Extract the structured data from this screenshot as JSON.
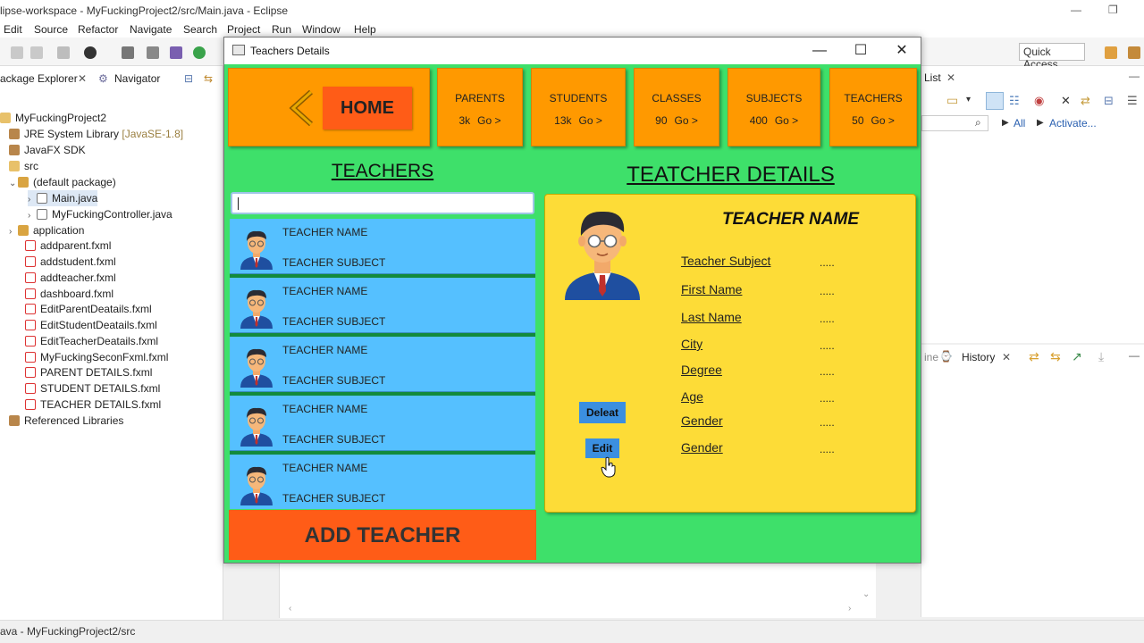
{
  "eclipse": {
    "title": "lipse-workspace - MyFuckingProject2/src/Main.java - Eclipse",
    "menu": [
      "Edit",
      "Source",
      "Refactor",
      "Navigate",
      "Search",
      "Project",
      "Run",
      "Window",
      "Help"
    ],
    "quick_access": "Quick Access",
    "package_explorer_tab": "ackage Explorer",
    "navigator_tab": "Navigator",
    "right_tab_list": "List",
    "right_tab_history": "History",
    "right_links": {
      "all": "All",
      "activate": "Activate..."
    },
    "status": "ava - MyFuckingProject2/src",
    "tree": [
      {
        "label": "MyFuckingProject2",
        "icon": "project-icon"
      },
      {
        "label": "JRE System Library",
        "suffix": "[JavaSE-1.8]",
        "icon": "library-icon"
      },
      {
        "label": "JavaFX SDK",
        "icon": "library-icon"
      },
      {
        "label": "src",
        "icon": "folder-icon"
      },
      {
        "label": "(default package)",
        "icon": "package-icon"
      },
      {
        "label": "Main.java",
        "icon": "java-file-icon"
      },
      {
        "label": "MyFuckingController.java",
        "icon": "java-file-icon"
      },
      {
        "label": "application",
        "icon": "package-icon"
      },
      {
        "label": "addparent.fxml",
        "icon": "fxml-file-icon"
      },
      {
        "label": "addstudent.fxml",
        "icon": "fxml-file-icon"
      },
      {
        "label": "addteacher.fxml",
        "icon": "fxml-file-icon"
      },
      {
        "label": "dashboard.fxml",
        "icon": "fxml-file-icon"
      },
      {
        "label": "EditParentDeatails.fxml",
        "icon": "fxml-file-icon"
      },
      {
        "label": "EditStudentDeatails.fxml",
        "icon": "fxml-file-icon"
      },
      {
        "label": "EditTeacherDeatails.fxml",
        "icon": "fxml-file-icon"
      },
      {
        "label": "MyFuckingSeconFxml.fxml",
        "icon": "fxml-file-icon"
      },
      {
        "label": "PARENT DETAILS.fxml",
        "icon": "fxml-file-icon"
      },
      {
        "label": "STUDENT DETAILS.fxml",
        "icon": "fxml-file-icon"
      },
      {
        "label": "TEACHER DETAILS.fxml",
        "icon": "fxml-file-icon"
      },
      {
        "label": "Referenced Libraries",
        "icon": "library-icon"
      }
    ]
  },
  "dialog": {
    "title": "Teachers Details",
    "home_label": "HOME",
    "nav": [
      {
        "label": "PARENTS",
        "count": "3k",
        "go": "Go >"
      },
      {
        "label": "STUDENTS",
        "count": "13k",
        "go": "Go >"
      },
      {
        "label": "CLASSES",
        "count": "90",
        "go": "Go >"
      },
      {
        "label": "SUBJECTS",
        "count": "400",
        "go": "Go >"
      },
      {
        "label": "TEACHERS",
        "count": "50",
        "go": "Go >"
      }
    ],
    "teachers_heading": "TEACHERS",
    "details_heading": "TEATCHER DETAILS",
    "search_value": "",
    "teachers": [
      {
        "name": "TEACHER NAME",
        "subject": "TEACHER SUBJECT"
      },
      {
        "name": "TEACHER NAME",
        "subject": "TEACHER SUBJECT"
      },
      {
        "name": "TEACHER NAME",
        "subject": "TEACHER SUBJECT"
      },
      {
        "name": "TEACHER NAME",
        "subject": "TEACHER SUBJECT"
      },
      {
        "name": "TEACHER NAME",
        "subject": "TEACHER SUBJECT"
      }
    ],
    "add_teacher": "ADD TEACHER",
    "detail": {
      "name": "TEACHER NAME",
      "fields": [
        {
          "label": "Teacher Subject",
          "value": "....."
        },
        {
          "label": "First Name",
          "value": "....."
        },
        {
          "label": "Last Name",
          "value": "....."
        },
        {
          "label": "City",
          "value": "....."
        },
        {
          "label": "Degree",
          "value": "....."
        },
        {
          "label": "Age",
          "value": "....."
        },
        {
          "label": "Gender",
          "value": "....."
        },
        {
          "label": "Gender",
          "value": "....."
        }
      ],
      "delete_label": "Deleat",
      "edit_label": "Edit"
    }
  },
  "colors": {
    "green_bg": "#3ee06a",
    "orange_card": "#ff9900",
    "red_orange": "#ff5c17",
    "list_blue": "#55c0ff",
    "detail_yellow": "#fddc37",
    "button_blue": "#3b8fe0"
  }
}
